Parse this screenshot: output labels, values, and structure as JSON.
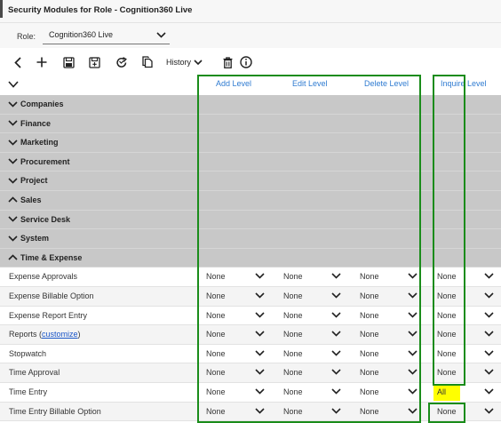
{
  "window": {
    "title": "Security Modules for Role - Cognition360 Live"
  },
  "role": {
    "label": "Role:",
    "value": "Cognition360 Live"
  },
  "toolbar": {
    "buttons": [
      "back-icon",
      "add-icon",
      "save-icon",
      "save-as-icon",
      "refresh-icon",
      "copy-icon",
      "delete-icon",
      "info-icon"
    ],
    "history_label": "History"
  },
  "columns": {
    "add": "Add Level",
    "edit": "Edit Level",
    "delete": "Delete Level",
    "inquire": "Inquire Level"
  },
  "groups": [
    "Companies",
    "Finance",
    "Marketing",
    "Procurement",
    "Project",
    "Sales",
    "Service Desk",
    "System",
    "Time & Expense"
  ],
  "rows": [
    {
      "label": "Expense Approvals",
      "add": "None",
      "edit": "None",
      "delete": "None",
      "inquire": "None"
    },
    {
      "label": "Expense Billable Option",
      "add": "None",
      "edit": "None",
      "delete": "None",
      "inquire": "None"
    },
    {
      "label": "Expense Report Entry",
      "add": "None",
      "edit": "None",
      "delete": "None",
      "inquire": "None"
    },
    {
      "label": "Reports (",
      "link": "customize",
      "label_end": ")",
      "add": "None",
      "edit": "None",
      "delete": "None",
      "inquire": "None"
    },
    {
      "label": "Stopwatch",
      "add": "None",
      "edit": "None",
      "delete": "None",
      "inquire": "None"
    },
    {
      "label": "Time Approval",
      "add": "None",
      "edit": "None",
      "delete": "None",
      "inquire": "None"
    },
    {
      "label": "Time Entry",
      "add": "None",
      "edit": "None",
      "delete": "None",
      "inquire": "All"
    },
    {
      "label": "Time Entry Billable Option",
      "add": "None",
      "edit": "None",
      "delete": "None",
      "inquire": "None"
    }
  ],
  "colors": {
    "link": "#2f7bd1",
    "group_bg": "#c8c8c8",
    "highlight": "#ffff00",
    "outline": "#1a8c1a"
  }
}
